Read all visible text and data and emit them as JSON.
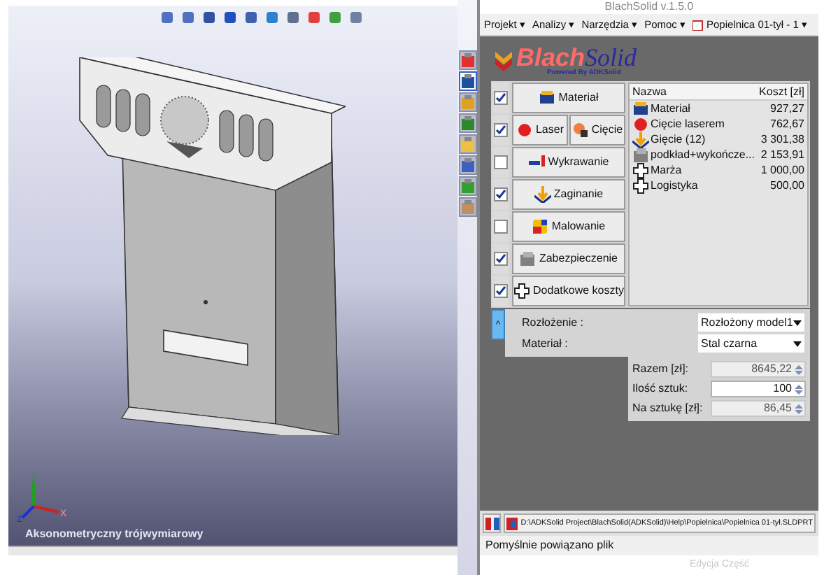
{
  "window": {
    "title": "BlachSolid v.1.5.0"
  },
  "viewport": {
    "view_label": "Aksonometryczny trójwymiarowy",
    "axes": [
      "X",
      "Y",
      "Z"
    ]
  },
  "side_strip": [
    {
      "selected": false
    },
    {
      "selected": true
    },
    {
      "selected": false
    },
    {
      "selected": false
    },
    {
      "selected": false
    },
    {
      "selected": false
    },
    {
      "selected": false
    },
    {
      "selected": false
    }
  ],
  "menu": [
    "Projekt ▾",
    "Analizy ▾",
    "Narzędzia ▾",
    "Pomoc ▾"
  ],
  "document": {
    "label": "Popielnica 01-tył - 1 ▾"
  },
  "logo": {
    "name_main": "Blach",
    "name_accent": "Solid",
    "tagline": "Powered By ADKSolid"
  },
  "operations": [
    {
      "checked": true,
      "buttons": [
        {
          "label": "Materiał",
          "kind": "material"
        }
      ]
    },
    {
      "checked": true,
      "buttons": [
        {
          "label": "Laser",
          "kind": "laser"
        },
        {
          "label": "Cięcie",
          "kind": "cut"
        }
      ]
    },
    {
      "checked": false,
      "buttons": [
        {
          "label": "Wykrawanie",
          "kind": "punch"
        }
      ]
    },
    {
      "checked": true,
      "buttons": [
        {
          "label": "Zaginanie",
          "kind": "bend"
        }
      ]
    },
    {
      "checked": false,
      "buttons": [
        {
          "label": "Malowanie",
          "kind": "paint"
        }
      ]
    },
    {
      "checked": true,
      "buttons": [
        {
          "label": "Zabezpieczenie",
          "kind": "protect"
        }
      ]
    },
    {
      "checked": true,
      "buttons": [
        {
          "label": "Dodatkowe koszty",
          "kind": "plus"
        }
      ]
    }
  ],
  "cost_table": {
    "columns": [
      "Nazwa",
      "Koszt [zł]"
    ],
    "rows": [
      {
        "name": "Materiał",
        "cost": "927,27",
        "kind": "material"
      },
      {
        "name": "Cięcie laserem",
        "cost": "762,67",
        "kind": "laser"
      },
      {
        "name": "Gięcie (12)",
        "cost": "3 301,38",
        "kind": "bend"
      },
      {
        "name": "podkład+wykończe...",
        "cost": "2 153,91",
        "kind": "protect"
      },
      {
        "name": "Marża",
        "cost": "1 000,00",
        "kind": "plus"
      },
      {
        "name": "Logistyka",
        "cost": "500,00",
        "kind": "plus"
      }
    ]
  },
  "collapse_button": {
    "label": "^"
  },
  "settings": [
    {
      "label": "Rozłożenie :",
      "value": "Rozłożony model1"
    },
    {
      "label": "Materiał :",
      "value": "Stal czarna"
    }
  ],
  "totals": [
    {
      "label": "Razem [zł]:",
      "value": "8645,22",
      "disabled": true
    },
    {
      "label": "Ilość sztuk:",
      "value": "100",
      "disabled": false
    },
    {
      "label": "Na sztukę [zł]:",
      "value": "86,45",
      "disabled": true
    }
  ],
  "file_path": "D:\\ADKSolid Project\\BlachSolid(ADKSolid)\\Help\\Popielnica\\Popielnica 01-tył.SLDPRT",
  "status": "Pomyślnie powiązano plik",
  "bottom_bar": {
    "mode": "Edycja Część"
  }
}
